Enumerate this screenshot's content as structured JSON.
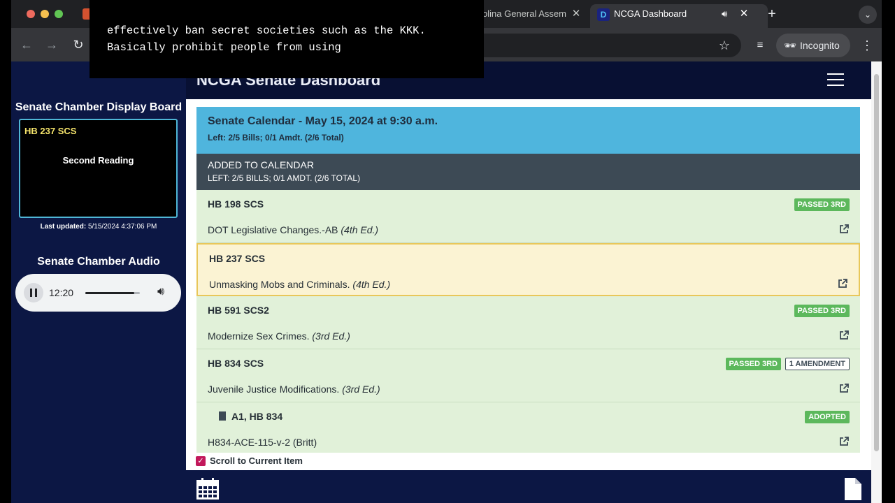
{
  "browser": {
    "tabs": [
      {
        "title": "olina General Assem",
        "active": false
      },
      {
        "title": "NCGA Dashboard",
        "active": true
      }
    ],
    "profile_label": "Incognito"
  },
  "caption": {
    "line1": "effectively ban secret societies such as the KKK.",
    "line2": "Basically prohibit people from using"
  },
  "app": {
    "title": "NCGA Senate Dashboard"
  },
  "display_board": {
    "title": "Senate Chamber Display Board",
    "bill": "HB 237 SCS",
    "status": "Second Reading",
    "last_updated_label": "Last updated:",
    "last_updated_value": "5/15/2024 4:37:06 PM"
  },
  "audio": {
    "title": "Senate Chamber Audio",
    "time": "12:20",
    "progress": 0.9
  },
  "calendar": {
    "title": "Senate Calendar - May 15, 2024 at 9:30 a.m.",
    "summary": "Left: 2/5 Bills; 0/1 Amdt. (2/6 Total)",
    "section_title": "ADDED TO CALENDAR",
    "section_summary": "LEFT: 2/5 BILLS; 0/1 AMDT. (2/6 TOTAL)",
    "items": [
      {
        "id": "HB 198 SCS",
        "title": "DOT Legislative Changes.-AB",
        "edition": "(4th Ed.)",
        "badges": [
          "PASSED 3RD"
        ]
      },
      {
        "id": "HB 237 SCS",
        "title": "Unmasking Mobs and Criminals.",
        "edition": "(4th Ed.)",
        "badges": [],
        "current": true
      },
      {
        "id": "HB 591 SCS2",
        "title": "Modernize Sex Crimes.",
        "edition": "(3rd Ed.)",
        "badges": [
          "PASSED 3RD"
        ]
      },
      {
        "id": "HB 834 SCS",
        "title": "Juvenile Justice Modifications.",
        "edition": "(3rd Ed.)",
        "badges": [
          "PASSED 3RD",
          "1 AMENDMENT"
        ]
      },
      {
        "id": "A1, HB 834",
        "title": "H834-ACE-115-v-2 (Britt)",
        "edition": "",
        "badges": [
          "ADOPTED"
        ],
        "amendment": true
      }
    ],
    "scroll_label": "Scroll to Current Item",
    "scroll_checked": true
  },
  "colors": {
    "page_bg": "#0c1744",
    "calendar_header": "#4fb5dd",
    "section_header": "#3d4a55",
    "item_bg": "#e1f1d9",
    "current_item_bg": "#fbf3d3",
    "current_item_border": "#e8c75a",
    "badge_green": "#5cb85c",
    "board_bill_text": "#f5e46b"
  },
  "icons": {
    "external_link": "external-link-icon",
    "calendar": "calendar-icon",
    "file": "file-icon",
    "menu": "hamburger-icon"
  }
}
